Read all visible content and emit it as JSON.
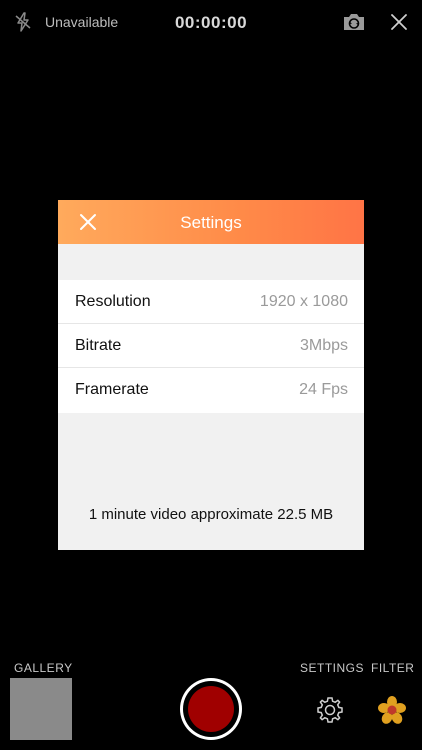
{
  "topbar": {
    "flash_icon": "flash-off-icon",
    "flash_status": "Unavailable",
    "timer": "00:00:00",
    "camera_switch_icon": "camera-switch-icon",
    "close_icon": "close-icon"
  },
  "modal": {
    "title": "Settings",
    "close_icon": "close-icon",
    "rows": [
      {
        "label": "Resolution",
        "value": "1920 x 1080"
      },
      {
        "label": "Bitrate",
        "value": "3Mbps"
      },
      {
        "label": "Framerate",
        "value": "24 Fps"
      }
    ],
    "footer": "1 minute video approximate 22.5 MB",
    "header_colors": [
      "#ffaa5c",
      "#ff7446"
    ]
  },
  "bottom": {
    "gallery_label": "GALLERY",
    "settings_label": "SETTINGS",
    "filter_label": "FILTER",
    "record_color": "#a00000",
    "gear_icon": "gear-icon",
    "filter_icon": "flower-icon"
  }
}
